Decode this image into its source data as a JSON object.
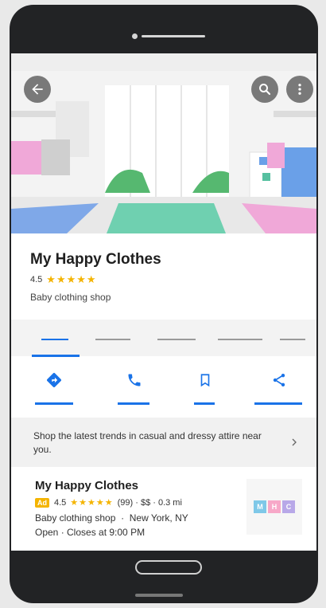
{
  "place": {
    "name": "My Happy Clothes",
    "rating": "4.5",
    "stars": "★★★★★",
    "category": "Baby clothing shop"
  },
  "tabs": {
    "count": 5,
    "active_index": 0
  },
  "icons": {
    "back": "arrow-left-icon",
    "search": "search-icon",
    "more": "more-vertical-icon",
    "directions": "directions-icon",
    "call": "phone-icon",
    "save": "bookmark-icon",
    "share": "share-icon",
    "chevron": "chevron-right-icon"
  },
  "promo": {
    "text": "Shop the latest trends in casual and dressy attire near you."
  },
  "ad": {
    "title": "My Happy Clothes",
    "badge": "Ad",
    "rating": "4.5",
    "stars": "★★★★★",
    "meta": "(99) · $$ · 0.3 mi",
    "line1": "Baby clothing shop  ·  New York, NY",
    "line2": "Open · Closes at 9:00 PM",
    "logo_letters": [
      "M",
      "H",
      "C"
    ]
  },
  "colors": {
    "accent": "#1a73e8",
    "star": "#f4b400",
    "logo_m": "#7fc8e8",
    "logo_h": "#f7a8c8",
    "logo_c": "#b8a8e8"
  }
}
